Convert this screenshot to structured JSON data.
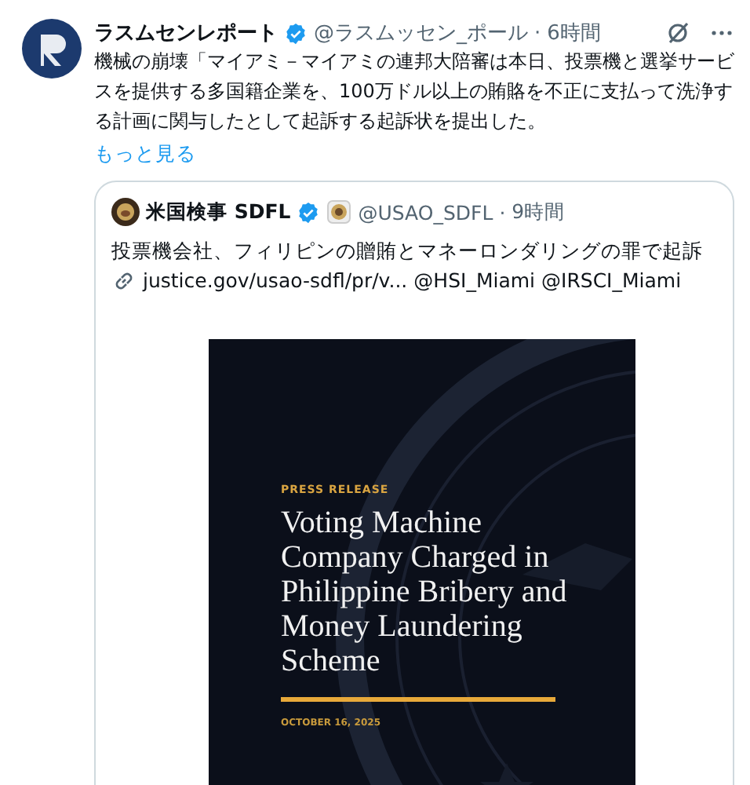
{
  "post": {
    "author": "ラスムセンレポート",
    "verified": true,
    "handle": "@ラスムッセン_ポール",
    "separator": "·",
    "time": "6時間",
    "text": "機械の崩壊「マイアミ－マイアミの連邦大陪審は本日、投票機と選挙サービスを提供する多国籍企業を、100万ドル以上の賄賂を不正に支払って洗浄する計画に関与したとして起訴する起訴状を提出した。",
    "more": "もっと見る"
  },
  "quote": {
    "author": "米国検事 SDFL",
    "verified": true,
    "handle": "@USAO_SDFL",
    "separator": "·",
    "time": "9時間",
    "text": "投票機会社、フィリピンの贈賄とマネーロンダリングの罪で起訴",
    "link": "justice.gov/usao-sdfl/pr/v...",
    "mentions": [
      "@HSI_Miami",
      "@IRSCI_Miami"
    ],
    "image": {
      "label": "PRESS RELEASE",
      "title": "Voting Machine Company Charged in Philippine Bribery and Money Laundering Scheme",
      "date": "OCTOBER 16, 2025"
    }
  }
}
